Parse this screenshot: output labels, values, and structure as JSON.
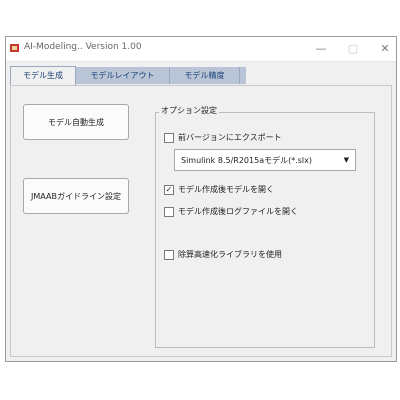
{
  "window": {
    "title": "AI-Modeling.. Version 1.00",
    "minimize_icon": "minimize-icon",
    "maximize_icon": "maximize-icon",
    "close_icon": "close-icon"
  },
  "tabs": [
    {
      "label": "モデル生成",
      "active": true
    },
    {
      "label": "モデルレイアウト",
      "active": false
    },
    {
      "label": "モデル精度",
      "active": false
    }
  ],
  "buttons": {
    "generate_label": "モデル自動生成",
    "jmaab_label": "JMAABガイドライン設定"
  },
  "options": {
    "title": "オプション設定",
    "export_prev_version": {
      "label": "前バージョンにエクスポート",
      "checked": false
    },
    "version_select": {
      "value": "Simulink 8.5/R2015aモデル(*.slx)"
    },
    "open_model_after": {
      "label": "モデル作成後モデルを開く",
      "checked": true
    },
    "open_log_after": {
      "label": "モデル作成後ログファイルを開く",
      "checked": false
    },
    "use_fast_library": {
      "label": "除算高速化ライブラリを使用",
      "checked": false
    }
  },
  "colors": {
    "tab_strip": "#b9c5d6",
    "tab_text": "#1a3f76",
    "window_bg": "#f0f0f0"
  }
}
